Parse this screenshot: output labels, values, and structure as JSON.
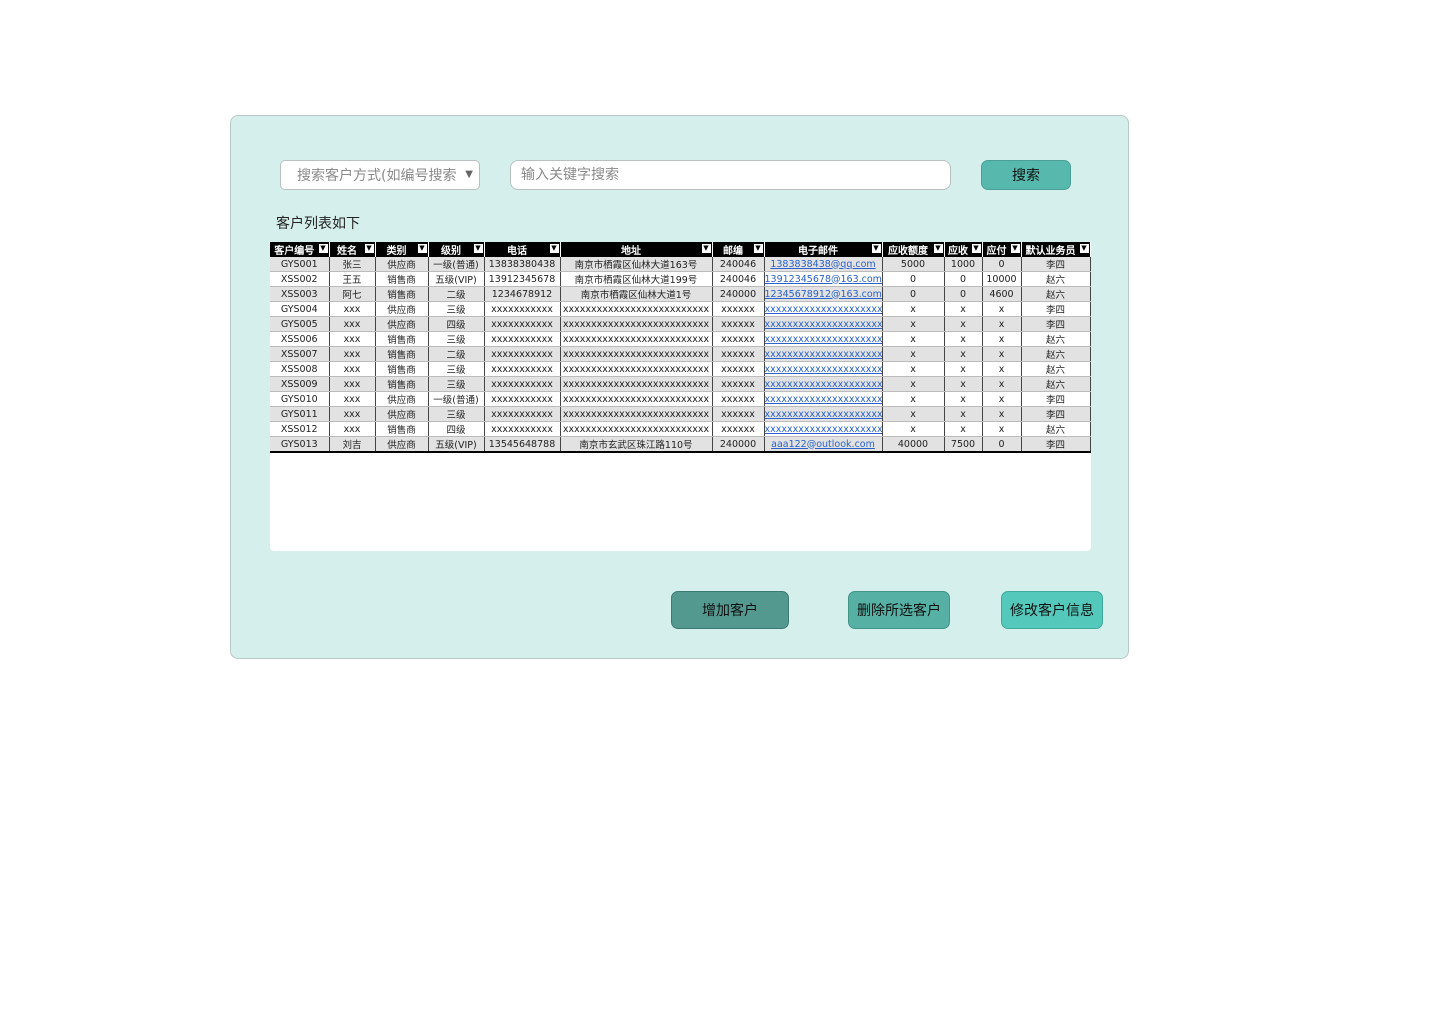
{
  "search": {
    "method_placeholder": "搜索客户方式(如编号搜索",
    "keyword_placeholder": "输入关键字搜索",
    "button_label": "搜索"
  },
  "list_title": "客户列表如下",
  "table": {
    "headers": [
      "客户编号",
      "姓名",
      "类别",
      "级别",
      "电话",
      "地址",
      "邮编",
      "电子邮件",
      "应收额度",
      "应收",
      "应付",
      "默认业务员"
    ],
    "rows": [
      [
        "GYS001",
        "张三",
        "供应商",
        "一级(普通)",
        "13838380438",
        "南京市栖霞区仙林大道163号",
        "240046",
        "1383838438@qq.com",
        "5000",
        "1000",
        "0",
        "李四"
      ],
      [
        "XSS002",
        "王五",
        "销售商",
        "五级(VIP)",
        "13912345678",
        "南京市栖霞区仙林大道199号",
        "240046",
        "13912345678@163.com",
        "0",
        "0",
        "10000",
        "赵六"
      ],
      [
        "XSS003",
        "阿七",
        "销售商",
        "二级",
        "1234678912",
        "南京市栖霞区仙林大道1号",
        "240000",
        "12345678912@163.com",
        "0",
        "0",
        "4600",
        "赵六"
      ],
      [
        "GYS004",
        "xxx",
        "供应商",
        "三级",
        "xxxxxxxxxxx",
        "xxxxxxxxxxxxxxxxxxxxxxxxxx",
        "xxxxxx",
        "xxxxxxxxxxxxxxxxxxxxx",
        "x",
        "x",
        "x",
        "李四"
      ],
      [
        "GYS005",
        "xxx",
        "供应商",
        "四级",
        "xxxxxxxxxxx",
        "xxxxxxxxxxxxxxxxxxxxxxxxxx",
        "xxxxxx",
        "xxxxxxxxxxxxxxxxxxxxx",
        "x",
        "x",
        "x",
        "李四"
      ],
      [
        "XSS006",
        "xxx",
        "销售商",
        "三级",
        "xxxxxxxxxxx",
        "xxxxxxxxxxxxxxxxxxxxxxxxxx",
        "xxxxxx",
        "xxxxxxxxxxxxxxxxxxxxx",
        "x",
        "x",
        "x",
        "赵六"
      ],
      [
        "XSS007",
        "xxx",
        "销售商",
        "二级",
        "xxxxxxxxxxx",
        "xxxxxxxxxxxxxxxxxxxxxxxxxx",
        "xxxxxx",
        "xxxxxxxxxxxxxxxxxxxxx",
        "x",
        "x",
        "x",
        "赵六"
      ],
      [
        "XSS008",
        "xxx",
        "销售商",
        "三级",
        "xxxxxxxxxxx",
        "xxxxxxxxxxxxxxxxxxxxxxxxxx",
        "xxxxxx",
        "xxxxxxxxxxxxxxxxxxxxx",
        "x",
        "x",
        "x",
        "赵六"
      ],
      [
        "XSS009",
        "xxx",
        "销售商",
        "三级",
        "xxxxxxxxxxx",
        "xxxxxxxxxxxxxxxxxxxxxxxxxx",
        "xxxxxx",
        "xxxxxxxxxxxxxxxxxxxxx",
        "x",
        "x",
        "x",
        "赵六"
      ],
      [
        "GYS010",
        "xxx",
        "供应商",
        "一级(普通)",
        "xxxxxxxxxxx",
        "xxxxxxxxxxxxxxxxxxxxxxxxxx",
        "xxxxxx",
        "xxxxxxxxxxxxxxxxxxxxx",
        "x",
        "x",
        "x",
        "李四"
      ],
      [
        "GYS011",
        "xxx",
        "供应商",
        "三级",
        "xxxxxxxxxxx",
        "xxxxxxxxxxxxxxxxxxxxxxxxxx",
        "xxxxxx",
        "xxxxxxxxxxxxxxxxxxxxx",
        "x",
        "x",
        "x",
        "李四"
      ],
      [
        "XSS012",
        "xxx",
        "销售商",
        "四级",
        "xxxxxxxxxxx",
        "xxxxxxxxxxxxxxxxxxxxxxxxxx",
        "xxxxxx",
        "xxxxxxxxxxxxxxxxxxxxx",
        "x",
        "x",
        "x",
        "赵六"
      ],
      [
        "GYS013",
        "刘吉",
        "供应商",
        "五级(VIP)",
        "13545648788",
        "南京市玄武区珠江路110号",
        "240000",
        "aaa122@outlook.com",
        "40000",
        "7500",
        "0",
        "李四"
      ]
    ]
  },
  "actions": {
    "add_label": "增加客户",
    "delete_label": "删除所选客户",
    "edit_label": "修改客户信息"
  }
}
